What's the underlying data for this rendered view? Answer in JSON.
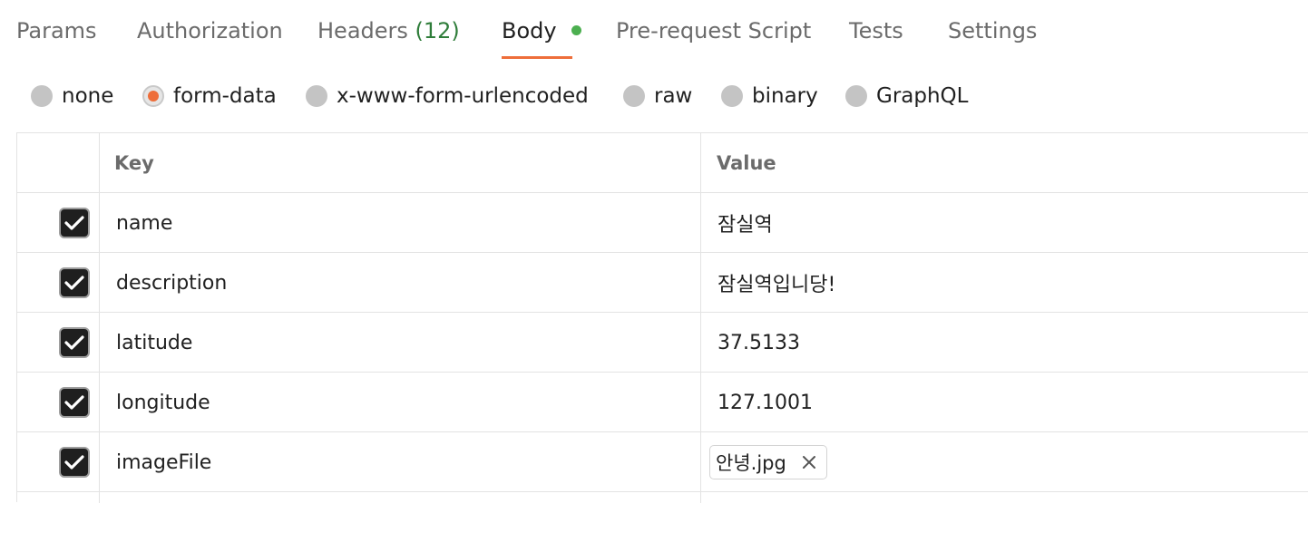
{
  "tabs": {
    "params": "Params",
    "authorization": "Authorization",
    "headers": "Headers",
    "headers_count": "(12)",
    "body": "Body",
    "prerequest": "Pre-request Script",
    "tests": "Tests",
    "settings": "Settings",
    "active": "Body"
  },
  "body_types": {
    "selected": "form-data",
    "options": [
      "none",
      "form-data",
      "x-www-form-urlencoded",
      "raw",
      "binary",
      "GraphQL"
    ]
  },
  "table": {
    "headers": {
      "key": "Key",
      "value": "Value"
    },
    "rows": [
      {
        "enabled": true,
        "key": "name",
        "value": "잠실역"
      },
      {
        "enabled": true,
        "key": "description",
        "value": "잠실역입니당!"
      },
      {
        "enabled": true,
        "key": "latitude",
        "value": "37.5133"
      },
      {
        "enabled": true,
        "key": "longitude",
        "value": "127.1001"
      },
      {
        "enabled": true,
        "key": "imageFile",
        "value": "안녕.jpg",
        "type": "file"
      }
    ]
  },
  "colors": {
    "accent": "#ee6e3a",
    "modified_dot": "#4caf50",
    "count_text": "#2f7d3a"
  },
  "icons": {
    "checkbox": "check-icon",
    "remove_file": "close-icon"
  }
}
